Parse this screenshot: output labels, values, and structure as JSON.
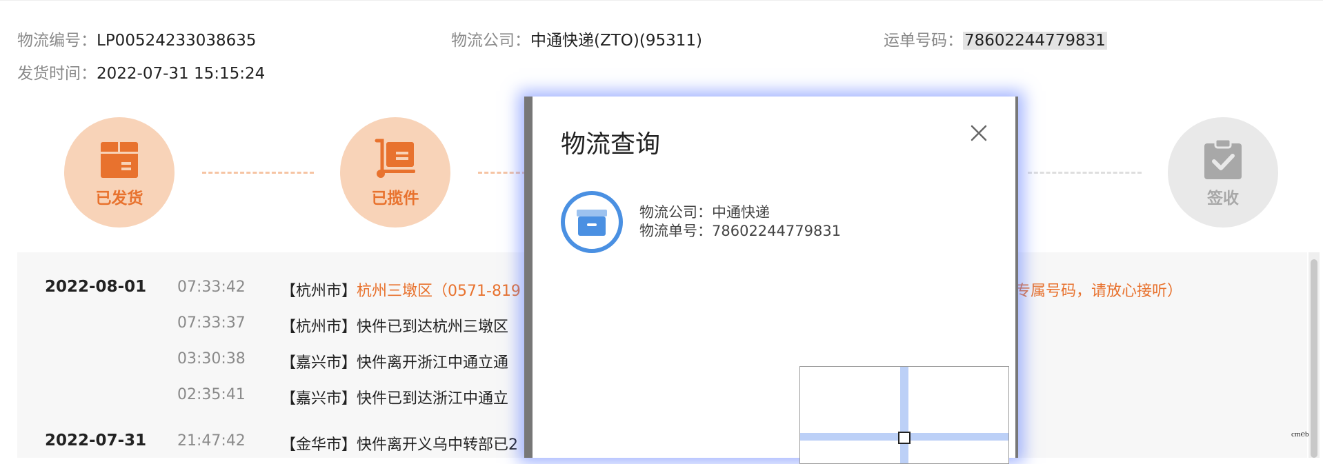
{
  "header": {
    "logistics_no_label": "物流编号：",
    "logistics_no": "LP00524233038635",
    "company_label": "物流公司：",
    "company": "中通快递(ZTO)(95311)",
    "waybill_label": "运单号码：",
    "waybill": "78602244779831",
    "ship_time_label": "发货时间：",
    "ship_time": "2022-07-31 15:15:24"
  },
  "steps": [
    {
      "label": "已发货",
      "icon": "box-icon",
      "color": "#e8722e"
    },
    {
      "label": "已揽件",
      "icon": "hand-truck-icon",
      "color": "#e8722e"
    },
    {
      "label": "签收",
      "icon": "clipboard-check-icon",
      "color": "#a8a8a8"
    }
  ],
  "timeline": {
    "groups": [
      {
        "date": "2022-08-01",
        "entries": [
          {
            "time": "07:33:42",
            "city": "【杭州市】",
            "text": "杭州三墩区（0571-819",
            "right_text": "专属号码，请放心接听）"
          },
          {
            "time": "07:33:37",
            "city": "【杭州市】",
            "text": "快件已到达杭州三墩区"
          },
          {
            "time": "03:30:38",
            "city": "【嘉兴市】",
            "text": "快件离开浙江中通立通"
          },
          {
            "time": "02:35:41",
            "city": "【嘉兴市】",
            "text": "快件已到达浙江中通立"
          }
        ]
      },
      {
        "date": "2022-07-31",
        "entries": [
          {
            "time": "21:47:42",
            "city": "【金华市】",
            "text": "快件离开义乌中转部已2"
          }
        ]
      }
    ]
  },
  "modal": {
    "title": "物流查询",
    "company_label": "物流公司：",
    "company": "中通快递",
    "number_label": "物流单号：",
    "number": "78602244779831",
    "accent": "#4a90e2"
  },
  "corner_text": "cm℮b",
  "colors": {
    "orange": "#e8722e",
    "orange_light": "#f8d3b8",
    "gray_step": "#e9e9e9",
    "blue": "#4a90e2"
  }
}
